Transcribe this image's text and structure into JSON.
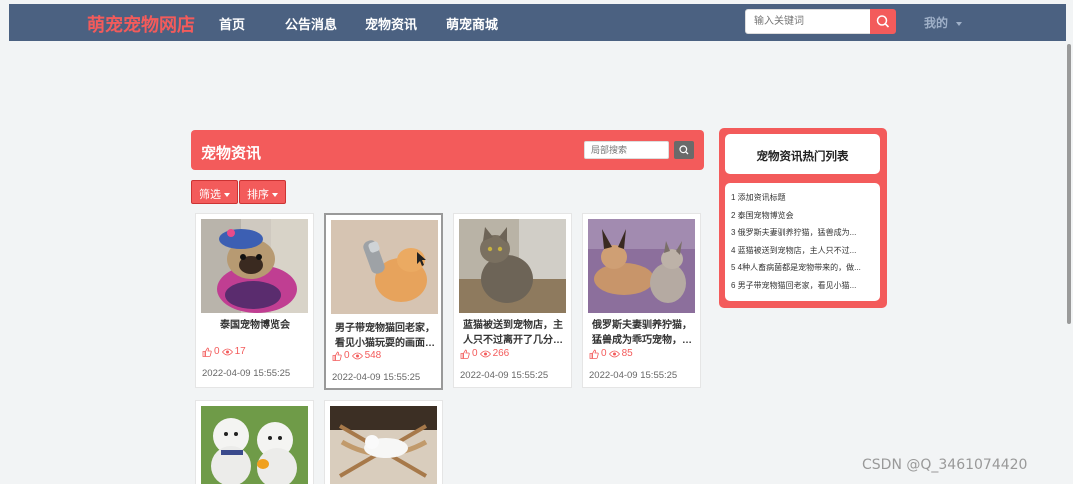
{
  "top_nav": {
    "brand": "萌宠宠物网店",
    "items": [
      "首页",
      "公告消息",
      "宠物资讯",
      "萌宠商城"
    ],
    "search_placeholder": "输入关键词",
    "user_menu": "我的"
  },
  "section": {
    "title": "宠物资讯",
    "local_search_placeholder": "局部搜索",
    "filter_label": "筛选",
    "sort_label": "排序"
  },
  "cards": [
    {
      "title": "泰国宠物博览会",
      "likes": "0",
      "views": "17",
      "date": "2022-04-09 15:55:25"
    },
    {
      "title": "男子带宠物猫回老家，看见小猫玩耍的画面…",
      "likes": "0",
      "views": "548",
      "date": "2022-04-09 15:55:25"
    },
    {
      "title": "蓝猫被送到宠物店，主人只不过离开了几分…",
      "likes": "0",
      "views": "266",
      "date": "2022-04-09 15:55:25"
    },
    {
      "title": "俄罗斯夫妻驯养狞猫，猛兽成为乖巧宠物，…",
      "likes": "0",
      "views": "85",
      "date": "2022-04-09 15:55:25"
    },
    {
      "title": "",
      "likes": "",
      "views": "",
      "date": ""
    },
    {
      "title": "",
      "likes": "",
      "views": "",
      "date": ""
    }
  ],
  "hot_list": {
    "title": "宠物资讯热门列表",
    "items": [
      "1  添加资讯标题",
      "2  泰国宠物博览会",
      "3  俄罗斯夫妻驯养狞猫，猛兽成为...",
      "4  蓝猫被送到宠物店，主人只不过...",
      "5  4种人畜病菌都是宠物带来的，做...",
      "6  男子带宠物猫回老家，看见小猫..."
    ]
  },
  "watermark": "CSDN @Q_3461074420",
  "colors": {
    "nav_bg": "#4b6181",
    "accent": "#f35b5b",
    "page_bg": "#f2f4f5"
  },
  "icons": [
    "search-icon",
    "thumb-up-icon",
    "eye-icon",
    "caret-down-icon",
    "mouse-pointer-icon"
  ]
}
